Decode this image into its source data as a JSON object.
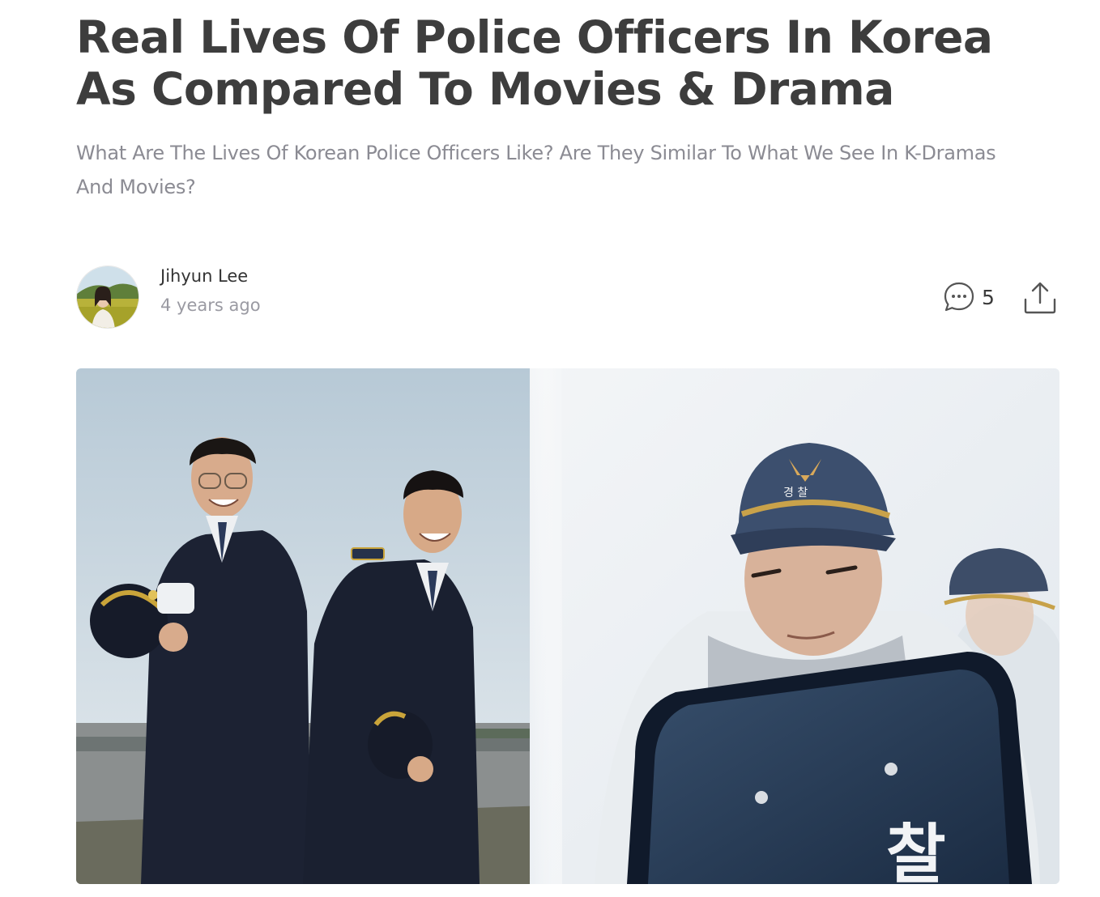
{
  "article": {
    "title": "Real Lives Of Police Officers In Korea As Compared To Movies & Drama",
    "subtitle": "What Are The Lives Of Korean Police Officers Like? Are They Similar To What We See In K-Dramas And Movies?"
  },
  "author": {
    "name": "Jihyun Lee",
    "posted": "4 years ago",
    "avatar_icon": "author-avatar-photo"
  },
  "actions": {
    "comment_icon": "comment-bubble-icon",
    "comment_count": "5",
    "share_icon": "share-upload-icon"
  },
  "hero_image": {
    "description_icon": "police-officers-photo",
    "cap_badge_text": "경 찰",
    "shield_text": "찰"
  },
  "colors": {
    "title": "#3d3d3d",
    "subtitle": "#8b8b93",
    "meta": "#9a9aa2",
    "uniform_navy": "#1c2233",
    "sky": "#c9d6df"
  }
}
